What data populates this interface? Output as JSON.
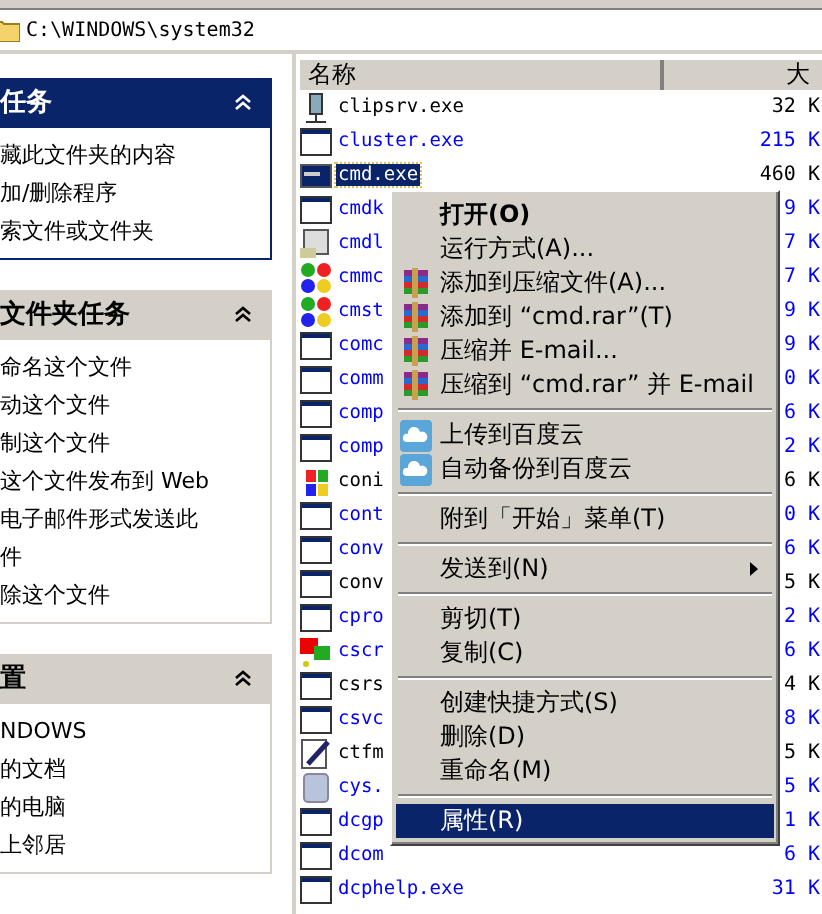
{
  "address": {
    "path": "C:\\WINDOWS\\system32"
  },
  "panels": [
    {
      "title": "任务",
      "items": [
        "藏此文件夹的内容",
        "加/删除程序",
        "索文件或文件夹"
      ]
    },
    {
      "title": "文件夹任务",
      "items": [
        "命名这个文件",
        "动这个文件",
        "制这个文件",
        "这个文件发布到 Web",
        "电子邮件形式发送此件",
        "除这个文件"
      ]
    },
    {
      "title": "置",
      "items": [
        "NDOWS",
        "的文档",
        "的电脑",
        "上邻居"
      ]
    }
  ],
  "list": {
    "columns": [
      "名称",
      "大"
    ],
    "rows": [
      {
        "kind": "plug",
        "name": "clipsrv.exe",
        "size": "32 K",
        "compressed": false,
        "selected": false
      },
      {
        "kind": "window",
        "name": "cluster.exe",
        "size": "215 K",
        "compressed": true,
        "selected": false
      },
      {
        "kind": "console",
        "name": "cmd.exe",
        "size": "460 K",
        "compressed": false,
        "selected": true
      },
      {
        "kind": "window",
        "name": "cmdk",
        "size": "9 K",
        "compressed": true,
        "selected": false
      },
      {
        "kind": "book",
        "name": "cmdl",
        "size": "7 K",
        "compressed": true,
        "selected": false
      },
      {
        "kind": "puzzle",
        "name": "cmmc",
        "size": "7 K",
        "compressed": true,
        "selected": false
      },
      {
        "kind": "puzzle",
        "name": "cmst",
        "size": "9 K",
        "compressed": true,
        "selected": false
      },
      {
        "kind": "window",
        "name": "comc",
        "size": "9 K",
        "compressed": true,
        "selected": false
      },
      {
        "kind": "window",
        "name": "comm",
        "size": "0 K",
        "compressed": true,
        "selected": false
      },
      {
        "kind": "window",
        "name": "comp",
        "size": "6 K",
        "compressed": true,
        "selected": false
      },
      {
        "kind": "window",
        "name": "comp",
        "size": "2 K",
        "compressed": true,
        "selected": false
      },
      {
        "kind": "flag",
        "name": "coni",
        "size": "6 K",
        "compressed": false,
        "selected": false
      },
      {
        "kind": "window",
        "name": "cont",
        "size": "0 K",
        "compressed": true,
        "selected": false
      },
      {
        "kind": "window",
        "name": "conv",
        "size": "6 K",
        "compressed": true,
        "selected": false
      },
      {
        "kind": "window",
        "name": "conv",
        "size": "5 K",
        "compressed": false,
        "selected": false
      },
      {
        "kind": "window",
        "name": "cpro",
        "size": "2 K",
        "compressed": true,
        "selected": false
      },
      {
        "kind": "screens",
        "name": "cscr",
        "size": "6 K",
        "compressed": true,
        "selected": false
      },
      {
        "kind": "window",
        "name": "csrs",
        "size": "4 K",
        "compressed": false,
        "selected": false
      },
      {
        "kind": "window",
        "name": "csvc",
        "size": "8 K",
        "compressed": true,
        "selected": false
      },
      {
        "kind": "pen",
        "name": "ctfm",
        "size": "5 K",
        "compressed": false,
        "selected": false
      },
      {
        "kind": "computer",
        "name": "cys.",
        "size": "5 K",
        "compressed": true,
        "selected": false
      },
      {
        "kind": "window",
        "name": "dcgp",
        "size": "1 K",
        "compressed": true,
        "selected": false
      },
      {
        "kind": "window",
        "name": "dcom",
        "size": "6 K",
        "compressed": true,
        "selected": false
      },
      {
        "kind": "window",
        "name": "dcphelp.exe",
        "size": "31 K",
        "compressed": true,
        "selected": false
      }
    ]
  },
  "context_menu": {
    "items": [
      {
        "kind": "plain",
        "label": "打开(O)",
        "default": true,
        "submenu": false,
        "selected": false
      },
      {
        "kind": "plain",
        "label": "运行方式(A)...",
        "default": false,
        "submenu": false,
        "selected": false
      },
      {
        "kind": "archive",
        "label": "添加到压缩文件(A)...",
        "default": false,
        "submenu": false,
        "selected": false
      },
      {
        "kind": "archive",
        "label": "添加到 “cmd.rar”(T)",
        "default": false,
        "submenu": false,
        "selected": false
      },
      {
        "kind": "archive",
        "label": "压缩并 E-mail...",
        "default": false,
        "submenu": false,
        "selected": false
      },
      {
        "kind": "archive",
        "label": "压缩到 “cmd.rar” 并 E-mail",
        "default": false,
        "submenu": false,
        "selected": false
      },
      {
        "kind": "separator"
      },
      {
        "kind": "cloud",
        "label": "上传到百度云",
        "default": false,
        "submenu": false,
        "selected": false
      },
      {
        "kind": "cloud",
        "label": "自动备份到百度云",
        "default": false,
        "submenu": false,
        "selected": false
      },
      {
        "kind": "separator"
      },
      {
        "kind": "plain",
        "label": "附到「开始」菜单(T)",
        "default": false,
        "submenu": false,
        "selected": false
      },
      {
        "kind": "separator"
      },
      {
        "kind": "plain",
        "label": "发送到(N)",
        "default": false,
        "submenu": true,
        "selected": false
      },
      {
        "kind": "separator"
      },
      {
        "kind": "plain",
        "label": "剪切(T)",
        "default": false,
        "submenu": false,
        "selected": false
      },
      {
        "kind": "plain",
        "label": "复制(C)",
        "default": false,
        "submenu": false,
        "selected": false
      },
      {
        "kind": "separator"
      },
      {
        "kind": "plain",
        "label": "创建快捷方式(S)",
        "default": false,
        "submenu": false,
        "selected": false
      },
      {
        "kind": "plain",
        "label": "删除(D)",
        "default": false,
        "submenu": false,
        "selected": false
      },
      {
        "kind": "plain",
        "label": "重命名(M)",
        "default": false,
        "submenu": false,
        "selected": false
      },
      {
        "kind": "separator"
      },
      {
        "kind": "plain",
        "label": "属性(R)",
        "default": false,
        "submenu": false,
        "selected": true
      }
    ]
  }
}
